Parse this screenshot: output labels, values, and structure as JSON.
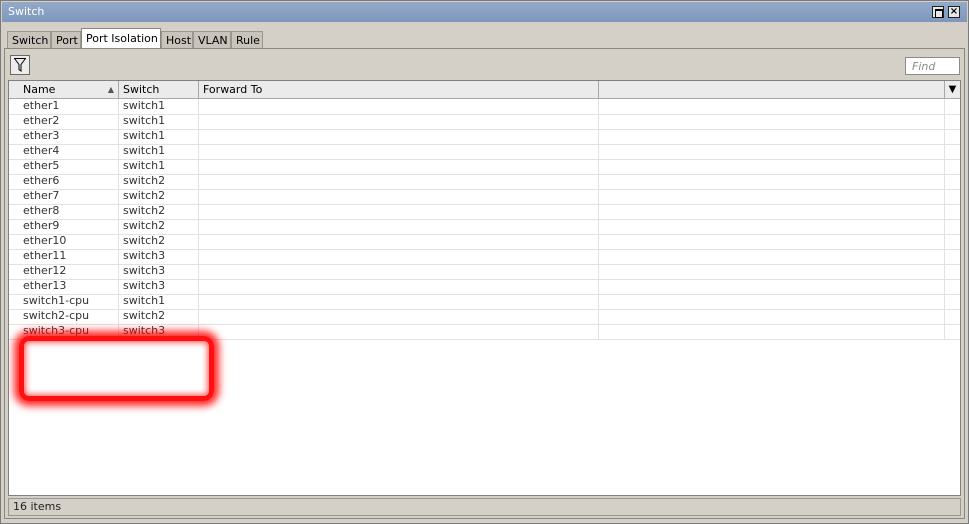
{
  "window": {
    "title": "Switch"
  },
  "tabs": [
    {
      "label": "Switch",
      "active": false
    },
    {
      "label": "Port",
      "active": false
    },
    {
      "label": "Port Isolation",
      "active": true
    },
    {
      "label": "Host",
      "active": false
    },
    {
      "label": "VLAN",
      "active": false
    },
    {
      "label": "Rule",
      "active": false
    }
  ],
  "toolbar": {
    "find_placeholder": "Find"
  },
  "table": {
    "columns": [
      "Name",
      "Switch",
      "Forward To",
      ""
    ],
    "rows": [
      {
        "name": "ether1",
        "switch": "switch1",
        "forward_to": ""
      },
      {
        "name": "ether2",
        "switch": "switch1",
        "forward_to": ""
      },
      {
        "name": "ether3",
        "switch": "switch1",
        "forward_to": ""
      },
      {
        "name": "ether4",
        "switch": "switch1",
        "forward_to": ""
      },
      {
        "name": "ether5",
        "switch": "switch1",
        "forward_to": ""
      },
      {
        "name": "ether6",
        "switch": "switch2",
        "forward_to": ""
      },
      {
        "name": "ether7",
        "switch": "switch2",
        "forward_to": ""
      },
      {
        "name": "ether8",
        "switch": "switch2",
        "forward_to": ""
      },
      {
        "name": "ether9",
        "switch": "switch2",
        "forward_to": ""
      },
      {
        "name": "ether10",
        "switch": "switch2",
        "forward_to": ""
      },
      {
        "name": "ether11",
        "switch": "switch3",
        "forward_to": ""
      },
      {
        "name": "ether12",
        "switch": "switch3",
        "forward_to": ""
      },
      {
        "name": "ether13",
        "switch": "switch3",
        "forward_to": ""
      },
      {
        "name": "switch1-cpu",
        "switch": "switch1",
        "forward_to": ""
      },
      {
        "name": "switch2-cpu",
        "switch": "switch2",
        "forward_to": ""
      },
      {
        "name": "switch3-cpu",
        "switch": "switch3",
        "forward_to": ""
      }
    ]
  },
  "status": {
    "items_count": "16 items"
  },
  "colors": {
    "highlight": "#ff1010",
    "titlebar": "#8aa0c4"
  }
}
